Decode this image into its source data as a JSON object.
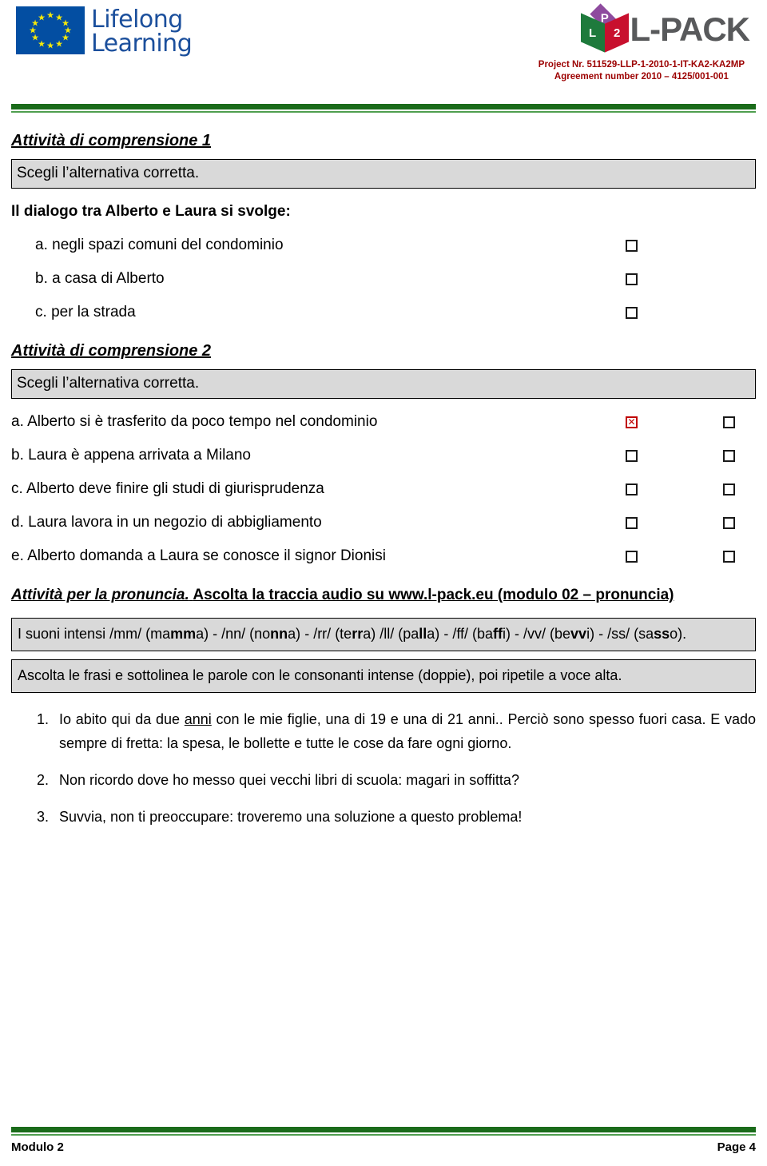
{
  "header": {
    "eu_logo": {
      "line1": "Lifelong",
      "line2": "Learning"
    },
    "lpack": {
      "cube_top": "P",
      "cube_left": "L",
      "cube_right": "2",
      "wordmark": "L-PACK"
    },
    "project_nr": "Project Nr. 511529-LLP-1-2010-1-IT-KA2-KA2MP",
    "agreement": "Agreement number 2010 – 4125/001-001"
  },
  "activity1": {
    "title": "Attività di comprensione 1",
    "instruction": "Scegli l’alternativa corretta.",
    "question": "Il dialogo tra Alberto e Laura si svolge:",
    "options": [
      {
        "letter": "a.",
        "text": "negli spazi comuni del condominio",
        "checked": false
      },
      {
        "letter": "b.",
        "text": "a casa di Alberto",
        "checked": false
      },
      {
        "letter": "c.",
        "text": "per la strada",
        "checked": false
      }
    ]
  },
  "activity2": {
    "title": "Attività di comprensione 2",
    "instruction": "Scegli l’alternativa corretta.",
    "options": [
      {
        "letter": "a.",
        "text": "Alberto si è trasferito da poco tempo nel condominio",
        "checked1": true,
        "checked2": false
      },
      {
        "letter": "b.",
        "text": "Laura è appena arrivata a Milano",
        "checked1": false,
        "checked2": false
      },
      {
        "letter": "c.",
        "text": "Alberto deve finire gli studi di giurisprudenza",
        "checked1": false,
        "checked2": false
      },
      {
        "letter": "d.",
        "text": "Laura lavora in un negozio di abbigliamento",
        "checked1": false,
        "checked2": false
      },
      {
        "letter": "e.",
        "text": "Alberto domanda a Laura se conosce il signor Dionisi",
        "checked1": false,
        "checked2": false
      }
    ],
    "check_mark": "✕"
  },
  "pronunciation": {
    "heading_italic": "Attività per la pronuncia.",
    "heading_rest": "Ascolta la traccia audio su www.l-pack.eu (modulo 02 – pronuncia)",
    "sounds_intro": "I suoni intensi",
    "sounds": [
      {
        "phoneme": "/mm/",
        "word_pre": "(ma",
        "word_bold": "mm",
        "word_post": "a)",
        "sep": " - "
      },
      {
        "phoneme": "/nn/",
        "word_pre": "(no",
        "word_bold": "nn",
        "word_post": "a)",
        "sep": "  -  "
      },
      {
        "phoneme": "/rr/",
        "word_pre": "(te",
        "word_bold": "rr",
        "word_post": "a)",
        "sep": "  "
      },
      {
        "phoneme": "/ll/",
        "word_pre": "(pa",
        "word_bold": "ll",
        "word_post": "a)",
        "sep": " - "
      },
      {
        "phoneme": "/ff/",
        "word_pre": "(ba",
        "word_bold": "ff",
        "word_post": "i)",
        "sep": " -  "
      },
      {
        "phoneme": "/vv/",
        "word_pre": "(be",
        "word_bold": "vv",
        "word_post": "i)",
        "sep": " - "
      },
      {
        "phoneme": "/ss/",
        "word_pre": "(sa",
        "word_bold": "ss",
        "word_post": "o).",
        "sep": ""
      }
    ],
    "instruction": "Ascolta le frasi e sottolinea le parole con le consonanti intense (doppie), poi ripetile a voce alta.",
    "sentences": [
      {
        "pre": "Io abito qui da due ",
        "underlined": "anni",
        "post": " con le mie figlie, una di 19 e una di 21 anni.. Perciò sono spesso fuori casa. E vado sempre di fretta: la spesa, le bollette e tutte le cose da fare ogni giorno."
      },
      {
        "pre": "Non ricordo dove ho messo quei vecchi libri di scuola: magari in soffitta?",
        "underlined": "",
        "post": ""
      },
      {
        "pre": "Suvvia, non ti preoccupare: troveremo una soluzione a questo problema!",
        "underlined": "",
        "post": ""
      }
    ]
  },
  "footer": {
    "left": "Modulo 2",
    "right": "Page 4"
  },
  "colors": {
    "rule_green_dark": "#1a6b1a",
    "rule_green_light": "#4f9e4f",
    "shade_gray": "#d9d9d9",
    "project_red": "#9c0000",
    "check_red": "#c00000",
    "eu_blue": "#034ea2"
  }
}
